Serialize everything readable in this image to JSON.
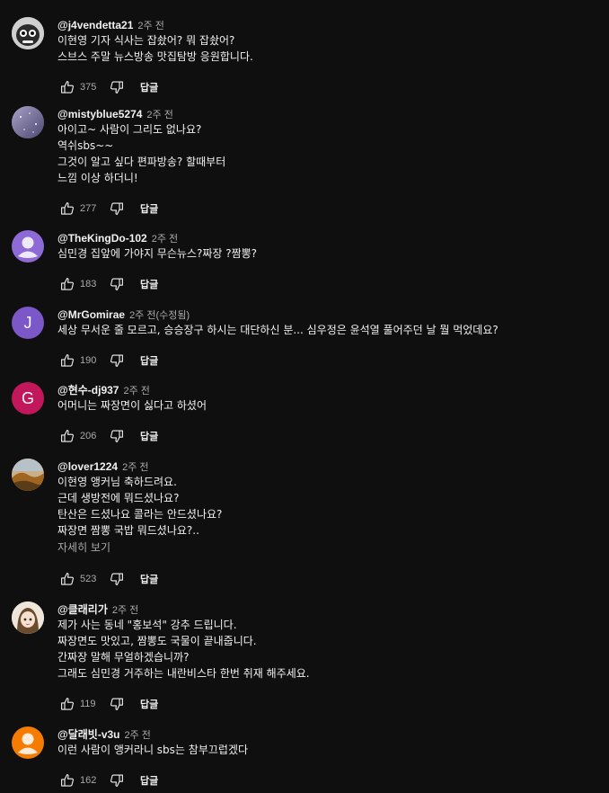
{
  "reply_label": "답글",
  "more_label": "자세히 보기",
  "comments": [
    {
      "author": "@j4vendetta21",
      "time": "2주 전",
      "lines": [
        "이현영 기자 식사는 잡솼어? 뭐 잡솼어?",
        "스브스 주말 뉴스방송 맛집탐방 응원합니다."
      ],
      "likes": "375",
      "avatar": {
        "type": "image",
        "icon": "cartoon-face-avatar",
        "bg": "#d8d8d8"
      }
    },
    {
      "author": "@mistyblue5274",
      "time": "2주 전",
      "lines": [
        "아이고~ 사람이 그리도 없나요?",
        "역쉬sbs~~",
        "그것이 알고 싶다 편파방송? 할때부터",
        "느낌 이상 하더니!"
      ],
      "likes": "277",
      "avatar": {
        "type": "image",
        "icon": "sky-photo-avatar",
        "bg": "#6e6a8e"
      }
    },
    {
      "author": "@TheKingDo-102",
      "time": "2주 전",
      "lines": [
        "심민경  집앞에  가야지 무슨뉴스?짜장 ?짬뽕?"
      ],
      "likes": "183",
      "avatar": {
        "type": "person",
        "icon": "default-person-avatar",
        "bg": "#8e6ad6"
      }
    },
    {
      "author": "@MrGomirae",
      "time": "2주 전(수정됨)",
      "lines": [
        "세상 무서운 줄 모르고, 승승장구 하시는 대단하신 분... 심우정은 윤석열 풀어주던 날 뭘 먹었데요?"
      ],
      "likes": "190",
      "avatar": {
        "type": "letter",
        "letter": "J",
        "icon": "letter-avatar",
        "bg": "#7b57c8"
      }
    },
    {
      "author": "@현수-dj937",
      "time": "2주 전",
      "lines": [
        "어머니는 짜장면이 싫다고 하셨어"
      ],
      "likes": "206",
      "avatar": {
        "type": "letter",
        "letter": "G",
        "icon": "letter-avatar",
        "bg": "#c2185b"
      }
    },
    {
      "author": "@lover1224",
      "time": "2주 전",
      "lines": [
        "이현영 앵커님 축하드려요.",
        "근데 생방전에 뭐드셨나요?",
        "탄산은 드셨나요 콜라는 안드셨나요?",
        "짜장면 짬뽕 국밥 뭐드셨나요?.."
      ],
      "more": true,
      "likes": "523",
      "avatar": {
        "type": "image",
        "icon": "landscape-photo-avatar",
        "bg": "#8a6a3a"
      }
    },
    {
      "author": "@클래리가",
      "time": "2주 전",
      "lines": [
        "제가 사는 동네 \"홍보석\" 강추 드립니다.",
        "짜장면도 맛있고, 짬뽕도 국물이 끝내줍니다.",
        "간짜장 말해 무얼하겠습니까?",
        "그래도 심민경 거주하는 내란비스타 한번 취재 해주세요."
      ],
      "likes": "119",
      "avatar": {
        "type": "image",
        "icon": "anime-girl-avatar",
        "bg": "#e6dccf"
      }
    },
    {
      "author": "@달래빗-v3u",
      "time": "2주 전",
      "lines": [
        "이런 사람이 앵커라니 sbs는 참부끄럽겠다"
      ],
      "likes": "162",
      "avatar": {
        "type": "person",
        "icon": "default-person-avatar",
        "bg": "#f57c00"
      }
    }
  ]
}
